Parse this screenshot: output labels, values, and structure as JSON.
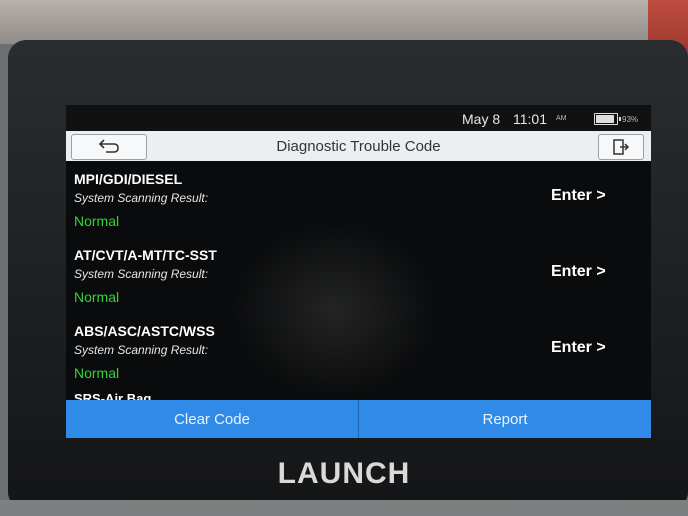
{
  "status_bar": {
    "date": "May 8",
    "time": "11:01",
    "ampm": "AM",
    "battery_percent": "93%"
  },
  "header": {
    "title": "Diagnostic Trouble Code"
  },
  "systems": [
    {
      "name": "MPI/GDI/DIESEL",
      "subtitle": "System Scanning Result:",
      "status": "Normal",
      "action": "Enter >"
    },
    {
      "name": "AT/CVT/A-MT/TC-SST",
      "subtitle": "System Scanning Result:",
      "status": "Normal",
      "action": "Enter >"
    },
    {
      "name": "ABS/ASC/ASTC/WSS",
      "subtitle": "System Scanning Result:",
      "status": "Normal",
      "action": "Enter >"
    }
  ],
  "partial_item": "SRS-Air Bag",
  "footer": {
    "clear_label": "Clear Code",
    "report_label": "Report"
  },
  "device": {
    "brand": "LAUNCH"
  },
  "colors": {
    "status_normal": "#35d33b",
    "button_blue": "#2f8ae8",
    "titlebar_bg": "#eceff1"
  }
}
